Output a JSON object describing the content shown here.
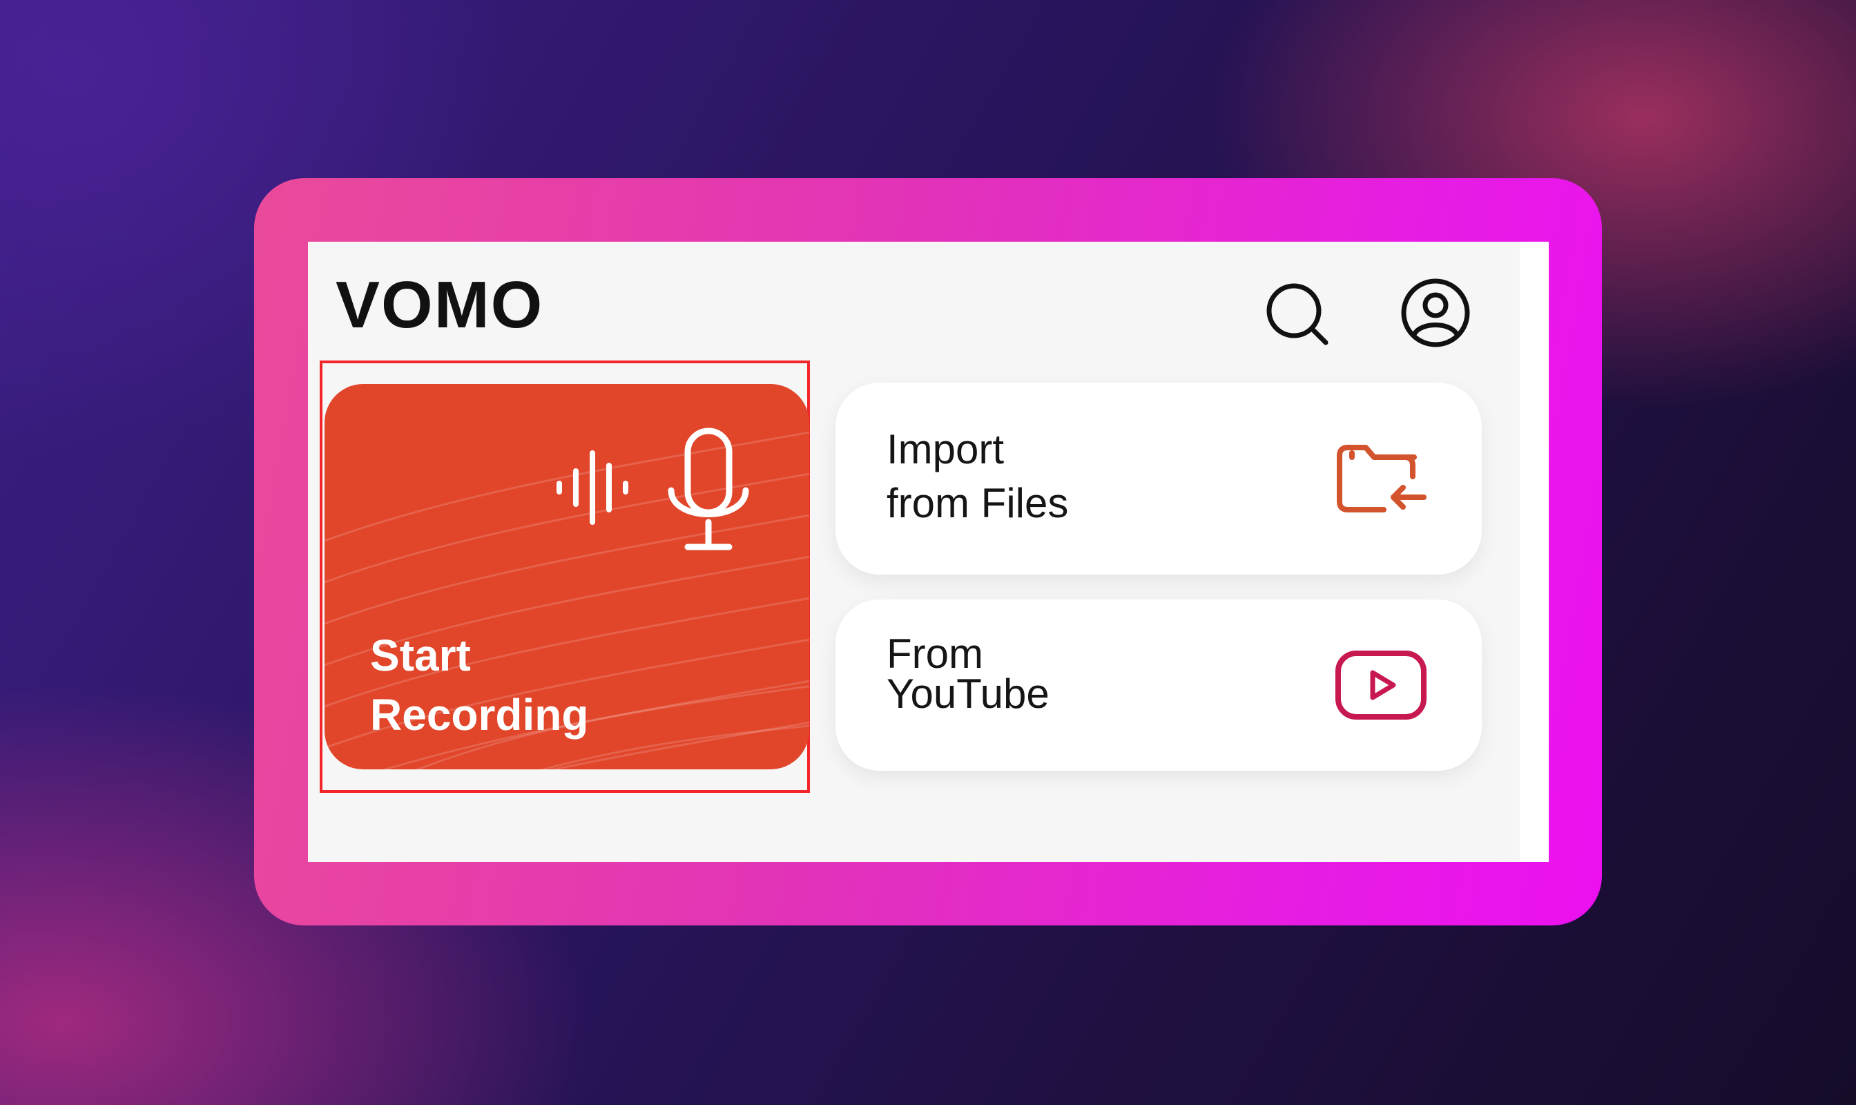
{
  "app": {
    "title": "VOMO"
  },
  "header": {
    "search_icon": "search-icon",
    "profile_icon": "profile-icon"
  },
  "record": {
    "line1": "Start",
    "line2": "Recording",
    "icon": "microphone-waveform-icon",
    "color": "#e1452a",
    "highlight_color": "#f2262a"
  },
  "import": {
    "line1": "Import",
    "line2": "from Files",
    "icon": "folder-import-icon",
    "icon_color": "#d2532c"
  },
  "youtube": {
    "line1": "From",
    "line2": "YouTube",
    "icon": "youtube-play-icon",
    "icon_color": "#c81850"
  },
  "frame": {
    "accent_color": "#e233b8"
  }
}
